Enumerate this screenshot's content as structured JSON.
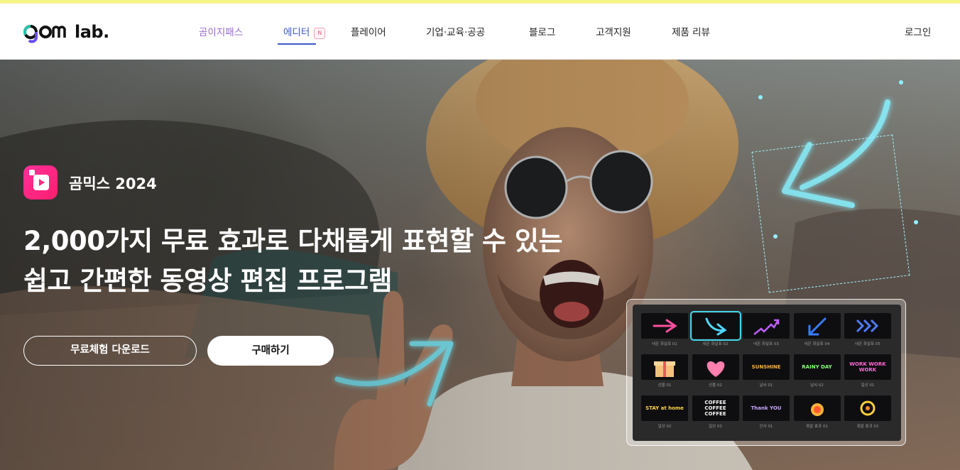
{
  "brand": {
    "logo_text": "lab.",
    "logo_prefix": "gom"
  },
  "nav": {
    "items": [
      {
        "label": "곰이지패스"
      },
      {
        "label": "에디터",
        "badge": "N"
      },
      {
        "label": "플레이어"
      },
      {
        "label": "기업·교육·공공"
      },
      {
        "label": "블로그"
      },
      {
        "label": "고객지원"
      },
      {
        "label": "제품 리뷰"
      }
    ],
    "login": "로그인"
  },
  "hero": {
    "product_name": "곰믹스 2024",
    "headline_line1": "2,000가지 무료 효과로 다채롭게 표현할 수 있는",
    "headline_line2": "쉽고 간편한 동영상 편집 프로그램",
    "cta_trial": "무료체험 다운로드",
    "cta_buy": "구매하기"
  },
  "effects_panel": {
    "items": [
      {
        "label": "네온 화살표 01"
      },
      {
        "label": "네온 화살표 02",
        "selected": true
      },
      {
        "label": "네온 화살표 03"
      },
      {
        "label": "네온 화살표 04"
      },
      {
        "label": "네온 화살표 05"
      },
      {
        "label": "선물 01"
      },
      {
        "label": "선물 02"
      },
      {
        "label": "날씨 01"
      },
      {
        "label": "날씨 02"
      },
      {
        "label": "일상 01"
      },
      {
        "label": "일상 02"
      },
      {
        "label": "일상 03"
      },
      {
        "label": "인사 01"
      },
      {
        "label": "폭발 효과 01"
      },
      {
        "label": "폭발 효과 02"
      }
    ],
    "thumb_texts": {
      "sunshine": "SUNSHINE",
      "rainy": "RAINY DAY",
      "work": "WORK WORK WORK",
      "stay": "STAY at home",
      "coffee": "COFFEE COFFEE COFFEE",
      "thanks": "Thank YOU"
    }
  },
  "colors": {
    "accent": "#3a59c9",
    "pass": "#9b6bd6",
    "neon": "#46d4e6",
    "topstrip": "#f7f48a",
    "app_icon": "#ff2f9a"
  }
}
